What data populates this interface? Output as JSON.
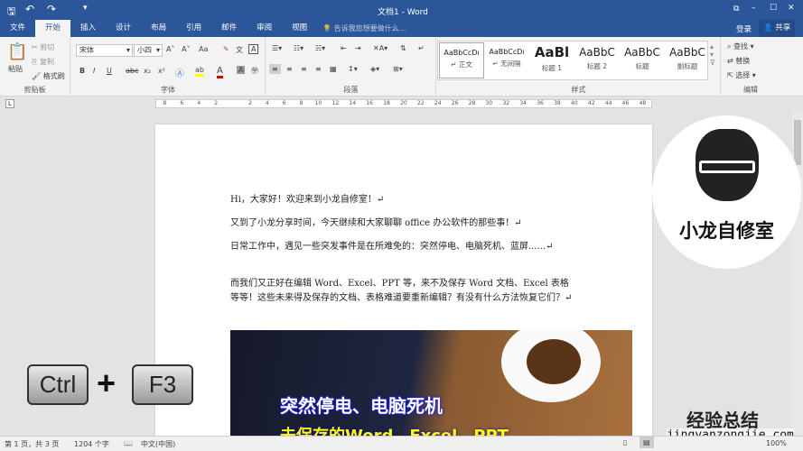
{
  "titlebar": {
    "title": "文档1 - Word",
    "minimize": "–",
    "maximize": "☐",
    "close": "✕"
  },
  "tabs": [
    "文件",
    "开始",
    "插入",
    "设计",
    "布局",
    "引用",
    "邮件",
    "审阅",
    "视图"
  ],
  "tell_me": "告诉我您想要做什么...",
  "login": "登录",
  "share": "共享",
  "clipboard": {
    "paste": "粘贴",
    "cut": "剪切",
    "copy": "复制",
    "format_painter": "格式刷",
    "label": "剪贴板"
  },
  "font": {
    "name": "宋体",
    "size": "小四",
    "label": "字体",
    "bold": "B",
    "italic": "I",
    "underline": "U",
    "strike": "abc",
    "sub": "x₂",
    "sup": "x²",
    "grow": "A˄",
    "shrink": "A˅",
    "case": "Aa"
  },
  "paragraph": {
    "label": "段落"
  },
  "styles": {
    "label": "样式",
    "items": [
      {
        "sample": "AaBbCcDı",
        "name": "↵ 正文"
      },
      {
        "sample": "AaBbCcDı",
        "name": "↵ 无间隔"
      },
      {
        "sample": "AaBl",
        "name": "标题 1"
      },
      {
        "sample": "AaBbC",
        "name": "标题 2"
      },
      {
        "sample": "AaBbC",
        "name": "标题"
      },
      {
        "sample": "AaBbC",
        "name": "副标题"
      }
    ]
  },
  "editing": {
    "label": "编辑",
    "find": "查找",
    "replace": "替换",
    "select": "选择"
  },
  "ruler": [
    "8",
    "6",
    "4",
    "2",
    "",
    "2",
    "4",
    "6",
    "8",
    "10",
    "12",
    "14",
    "16",
    "18",
    "20",
    "22",
    "24",
    "26",
    "28",
    "30",
    "32",
    "34",
    "36",
    "38",
    "40",
    "42",
    "44",
    "46",
    "48"
  ],
  "doc": {
    "paragraphs": [
      "Hi，大家好！欢迎来到小龙自修室！↵",
      "又到了小龙分享时间，今天继续和大家聊聊 office 办公软件的那些事！↵",
      "日常工作中，遇见一些突发事件是在所难免的：突然停电、电脑死机、蓝屏......↵",
      "而我们又正好在编辑 Word、Excel、PPT 等，来不及保存 Word 文档、Excel 表格等等！这些未来得及保存的文档、表格难道要重新编辑？有没有什么方法恢复它们？↵"
    ],
    "image_caption": "突然停电、电脑死机",
    "image_caption2": "未保存的Word、Excel、PPT"
  },
  "logo": {
    "text": "小龙自修室"
  },
  "shortcut": {
    "key1": "Ctrl",
    "plus": "+",
    "key2": "F3"
  },
  "watermark": {
    "cn": "经验总结",
    "url": "jingyanzongjie.com"
  },
  "status": {
    "page": "第 1 页，共 3 页",
    "words": "1204 个字",
    "lang": "中文(中国)",
    "zoom": "100%"
  }
}
